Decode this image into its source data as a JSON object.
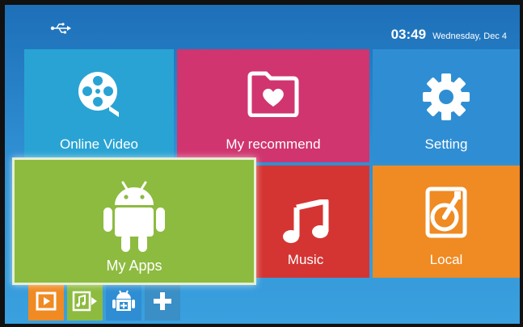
{
  "status_bar": {
    "time": "03:49",
    "date": "Wednesday, Dec 4"
  },
  "tiles": {
    "online_video": {
      "label": "Online Video",
      "color": "#29a3d4",
      "icon": "film-reel-icon"
    },
    "my_recommend": {
      "label": "My recommend",
      "color": "#d0356f",
      "icon": "folder-heart-icon"
    },
    "setting": {
      "label": "Setting",
      "color": "#2f8ed3",
      "icon": "gear-icon"
    },
    "my_apps": {
      "label": "My Apps",
      "color": "#8dbb3f",
      "icon": "android-icon",
      "focused": true
    },
    "music": {
      "label": "Music",
      "color": "#d43533",
      "icon": "music-note-icon"
    },
    "local": {
      "label": "Local",
      "color": "#f08a22",
      "icon": "hard-disk-icon"
    }
  },
  "dock": [
    {
      "icon": "video-player-icon",
      "color": "#f08a22"
    },
    {
      "icon": "music-file-icon",
      "color": "#8dbb3f"
    },
    {
      "icon": "app-store-icon",
      "color": "#2f8ed3"
    },
    {
      "icon": "add-icon",
      "color": "#3a8fc6"
    }
  ]
}
